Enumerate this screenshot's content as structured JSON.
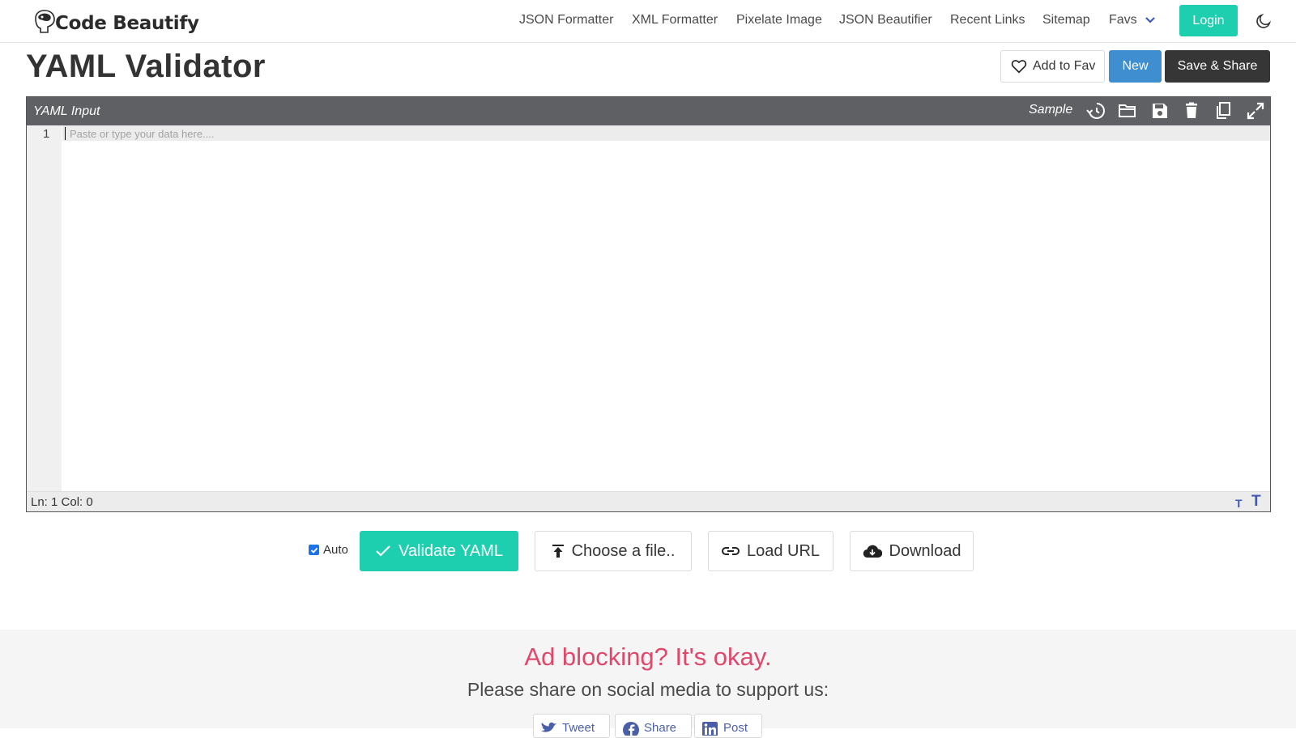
{
  "brand": {
    "name": "Code Beautify"
  },
  "nav": {
    "links": [
      "JSON Formatter",
      "XML Formatter",
      "Pixelate Image",
      "JSON Beautifier",
      "Recent Links",
      "Sitemap",
      "Favs"
    ],
    "login_label": "Login"
  },
  "page": {
    "title": "YAML Validator",
    "add_fav_label": "Add to Fav",
    "new_label": "New",
    "save_share_label": "Save & Share"
  },
  "editor": {
    "header_title": "YAML Input",
    "sample_label": "Sample",
    "toolbar_icons": [
      "history-icon",
      "folder-open-icon",
      "save-icon",
      "trash-icon",
      "copy-icon",
      "fullscreen-icon"
    ],
    "line_number": "1",
    "placeholder": "Paste or type your data here....",
    "status": "Ln: 1 Col: 0",
    "font_small_label": "T",
    "font_large_label": "T"
  },
  "actions": {
    "auto_label": "Auto",
    "auto_checked": true,
    "validate_label": "Validate YAML",
    "choose_file_label": "Choose a file..",
    "load_url_label": "Load URL",
    "download_label": "Download"
  },
  "ad": {
    "title": "Ad blocking? It's okay.",
    "subtitle": "Please share on social media to support us:",
    "share_buttons": [
      "Tweet",
      "Share",
      "Post"
    ]
  },
  "colors": {
    "accent": "#1dcfae",
    "blue": "#3e8ed0",
    "dark": "#363636",
    "ad_title": "#e0486b"
  }
}
